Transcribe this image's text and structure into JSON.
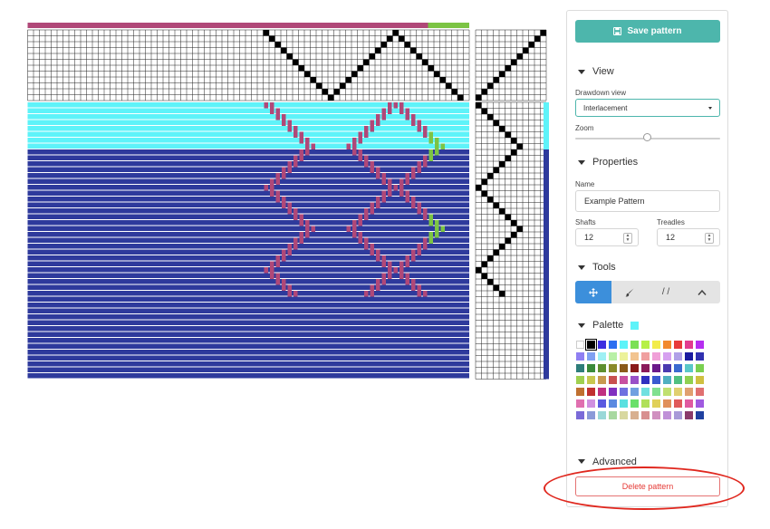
{
  "toolbar": {
    "save_label": "Save pattern"
  },
  "view": {
    "title": "View",
    "drawdown_label": "Drawdown view",
    "drawdown_value": "Interlacement",
    "zoom_label": "Zoom",
    "zoom_value": 0.5
  },
  "properties": {
    "title": "Properties",
    "name_label": "Name",
    "name_value": "Example Pattern",
    "shafts_label": "Shafts",
    "shafts_value": "12",
    "treadles_label": "Treadles",
    "treadles_value": "12"
  },
  "tools": {
    "title": "Tools",
    "items": [
      "move-icon",
      "brush-icon",
      "straight-draw-icon",
      "point-draw-icon"
    ],
    "active_index": 0,
    "straight_label": "/ /"
  },
  "palette": {
    "title": "Palette",
    "selected_color": "#5ef3f9",
    "rows": [
      [
        "#ffffff",
        "#000000",
        "#3b2fe0",
        "#2b6ff0",
        "#5ef3f9",
        "#7be055",
        "#b6f046",
        "#f2ec4b",
        "#f28a2c",
        "#e83a3a",
        "#e23b8f",
        "#b62ef0"
      ],
      [
        "#8f7ff2",
        "#7fa0f2",
        "#9ef0f4",
        "#b8f0a6",
        "#ecf29a",
        "#f2c48f",
        "#f0a0a0",
        "#f0a0d8",
        "#d6a0f0",
        "#b0a0e8",
        "#1a1aa0",
        "#3030b0"
      ],
      [
        "#2e7d7a",
        "#3a8a3a",
        "#5f8f2f",
        "#8a8a2a",
        "#8a5a1a",
        "#8a1a1a",
        "#8a1a5a",
        "#6a1a8a",
        "#4a3ab0",
        "#3a6ad0",
        "#5ac8c8",
        "#7ad050"
      ],
      [
        "#a0d050",
        "#c8c850",
        "#c89a50",
        "#c85050",
        "#c850a0",
        "#9a50c8",
        "#3030c0",
        "#3a5ad0",
        "#50b0c0",
        "#50c080",
        "#90d050",
        "#d0c040"
      ],
      [
        "#c07030",
        "#c03030",
        "#c03080",
        "#8030c0",
        "#7070e0",
        "#70a0e0",
        "#70e0e0",
        "#80e090",
        "#c0e070",
        "#e0d070",
        "#e0a070",
        "#e07070"
      ],
      [
        "#e070b0",
        "#d090e0",
        "#5a5ae0",
        "#5a8ae0",
        "#5ae0e0",
        "#6ae06a",
        "#b0e05a",
        "#e0d05a",
        "#e0905a",
        "#e05a5a",
        "#e05aa0",
        "#a05ae0"
      ],
      [
        "#7a6ad8",
        "#8a9ad8",
        "#9ad8d8",
        "#a8d8a0",
        "#d8d8a0",
        "#d8b090",
        "#d89090",
        "#d090c0",
        "#c090d8",
        "#a89ad8",
        "#8a3a6a",
        "#2040a0"
      ]
    ]
  },
  "advanced": {
    "title": "Advanced"
  },
  "danger": {
    "delete_label": "Delete pattern"
  },
  "colors": {
    "accent": "#4db6ac",
    "warp_main": "#b04878",
    "warp_accent": "#7cc444",
    "weft_light": "#5ef3f9",
    "weft_dark": "#2e3a9c",
    "danger": "#e53935",
    "tool_active": "#3c8fdb"
  },
  "draft": {
    "threading": [
      0,
      1,
      2,
      3,
      4,
      5,
      6,
      7,
      8,
      9,
      10,
      11,
      10,
      9,
      8,
      7,
      6,
      5,
      4,
      3,
      2,
      1,
      0,
      1,
      2,
      3,
      4,
      5,
      6,
      7,
      8,
      9,
      10,
      11
    ],
    "treadling": [
      0,
      1,
      2,
      3,
      4,
      5,
      6,
      7,
      6,
      5,
      4,
      3,
      2,
      1,
      0,
      1,
      2,
      3,
      4,
      5,
      6,
      7,
      6,
      5,
      4,
      3,
      2,
      1,
      0,
      1,
      2,
      3,
      4
    ],
    "weft_light_picks": 8
  }
}
